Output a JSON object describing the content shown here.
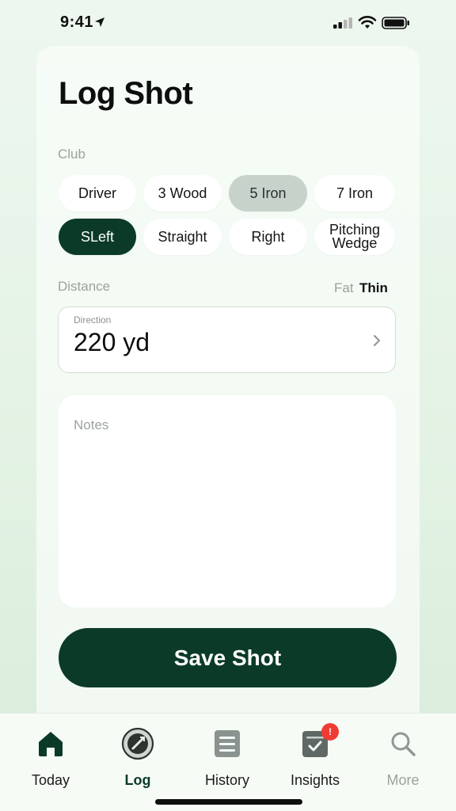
{
  "status": {
    "time": "9:41"
  },
  "title": "Log Shot",
  "club": {
    "label": "Club",
    "chips_row1": [
      "Driver",
      "3 Wood",
      "5 Iron",
      "7 Iron"
    ],
    "chips_row2": [
      "SLeft",
      "Straight",
      "Right",
      "Pitching Wedge"
    ]
  },
  "distance": {
    "label": "Distance",
    "toggle": [
      "Fat",
      "Thin"
    ],
    "field_label": "Direction",
    "value": "220 yd"
  },
  "notes": {
    "placeholder": "Notes"
  },
  "save_label": "Save Shot",
  "tabs": [
    "Today",
    "Log",
    "History",
    "Insights",
    "More"
  ],
  "insights_badge": "!",
  "colors": {
    "primary": "#0b3b28",
    "chip_selected": "#c7d2cb",
    "badge": "#ef3b34"
  }
}
